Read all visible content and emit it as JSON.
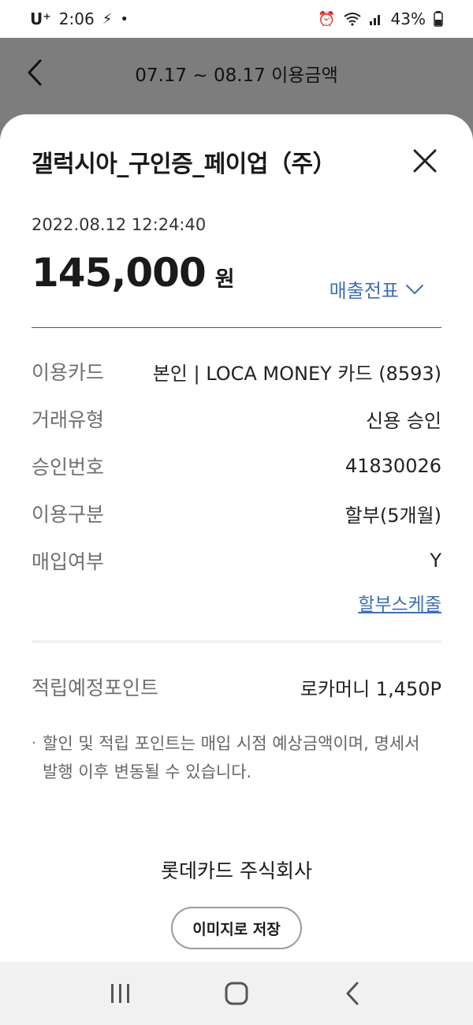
{
  "status_bar": {
    "carrier": "U⁺",
    "time": "2:06",
    "battery": "43%"
  },
  "header": {
    "title": "07.17 ~ 08.17 이용금액"
  },
  "detail": {
    "merchant": "갤럭시아_구인증_페이업（주）",
    "datetime": "2022.08.12 12:24:40",
    "amount": "145,000",
    "currency": "원",
    "receipt_label": "매출전표",
    "rows": [
      {
        "label": "이용카드",
        "value": "본인 | LOCA MONEY 카드 (8593)"
      },
      {
        "label": "거래유형",
        "value": "신용 승인"
      },
      {
        "label": "승인번호",
        "value": "41830026"
      },
      {
        "label": "이용구분",
        "value": "할부(5개월)"
      },
      {
        "label": "매입여부",
        "value": "Y"
      }
    ],
    "schedule_link": "할부스케줄",
    "points_label": "적립예정포인트",
    "points_value": "로카머니 1,450P",
    "notice_line1": "할인 및 적립 포인트는 매입 시점 예상금액이며, 명세서",
    "notice_line2": "발행 이후 변동될 수 있습니다.",
    "company": "롯데카드 주식회사",
    "save_button": "이미지로 저장"
  },
  "colors": {
    "accent": "#3e6fb4",
    "dim_overlay": "#7d7d7d"
  }
}
